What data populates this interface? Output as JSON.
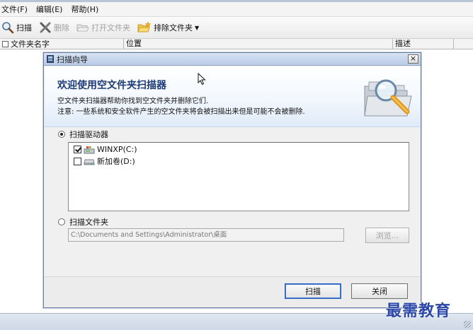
{
  "menubar": {
    "items": [
      "文件(F)",
      "编辑(E)",
      "帮助(H)"
    ]
  },
  "toolbar": {
    "scan_label": "扫描",
    "delete_label": "删除",
    "open_folder_label": "打开文件夹",
    "exclude_folder_label": "排除文件夹"
  },
  "columns": {
    "name": "文件夹名字",
    "location": "位置",
    "description": "描述"
  },
  "dialog": {
    "title": "扫描向导",
    "close_glyph": "×",
    "banner_title": "欢迎使用空文件夹扫描器",
    "banner_desc": "空文件夹扫描器帮助你找到空文件夹并删除它们.",
    "banner_note": "注意: 一些系统和安全软件产生的空文件夹将会被扫描出来但是可能不会被删除.",
    "scan_drives_label": "扫描驱动器",
    "drives": [
      {
        "label": "WINXP(C:)",
        "checked": true
      },
      {
        "label": "新加卷(D:)",
        "checked": false
      }
    ],
    "scan_folder_label": "扫描文件夹",
    "folder_path": "C:\\Documents and Settings\\Administrator\\桌面",
    "browse_label": "浏览...",
    "scan_button": "扫描",
    "close_button": "关闭"
  },
  "watermark": "最需教育",
  "colors": {
    "banner_title": "#1d3b78",
    "watermark": "#2b47a8",
    "title_bar": "#b9cbe6"
  }
}
